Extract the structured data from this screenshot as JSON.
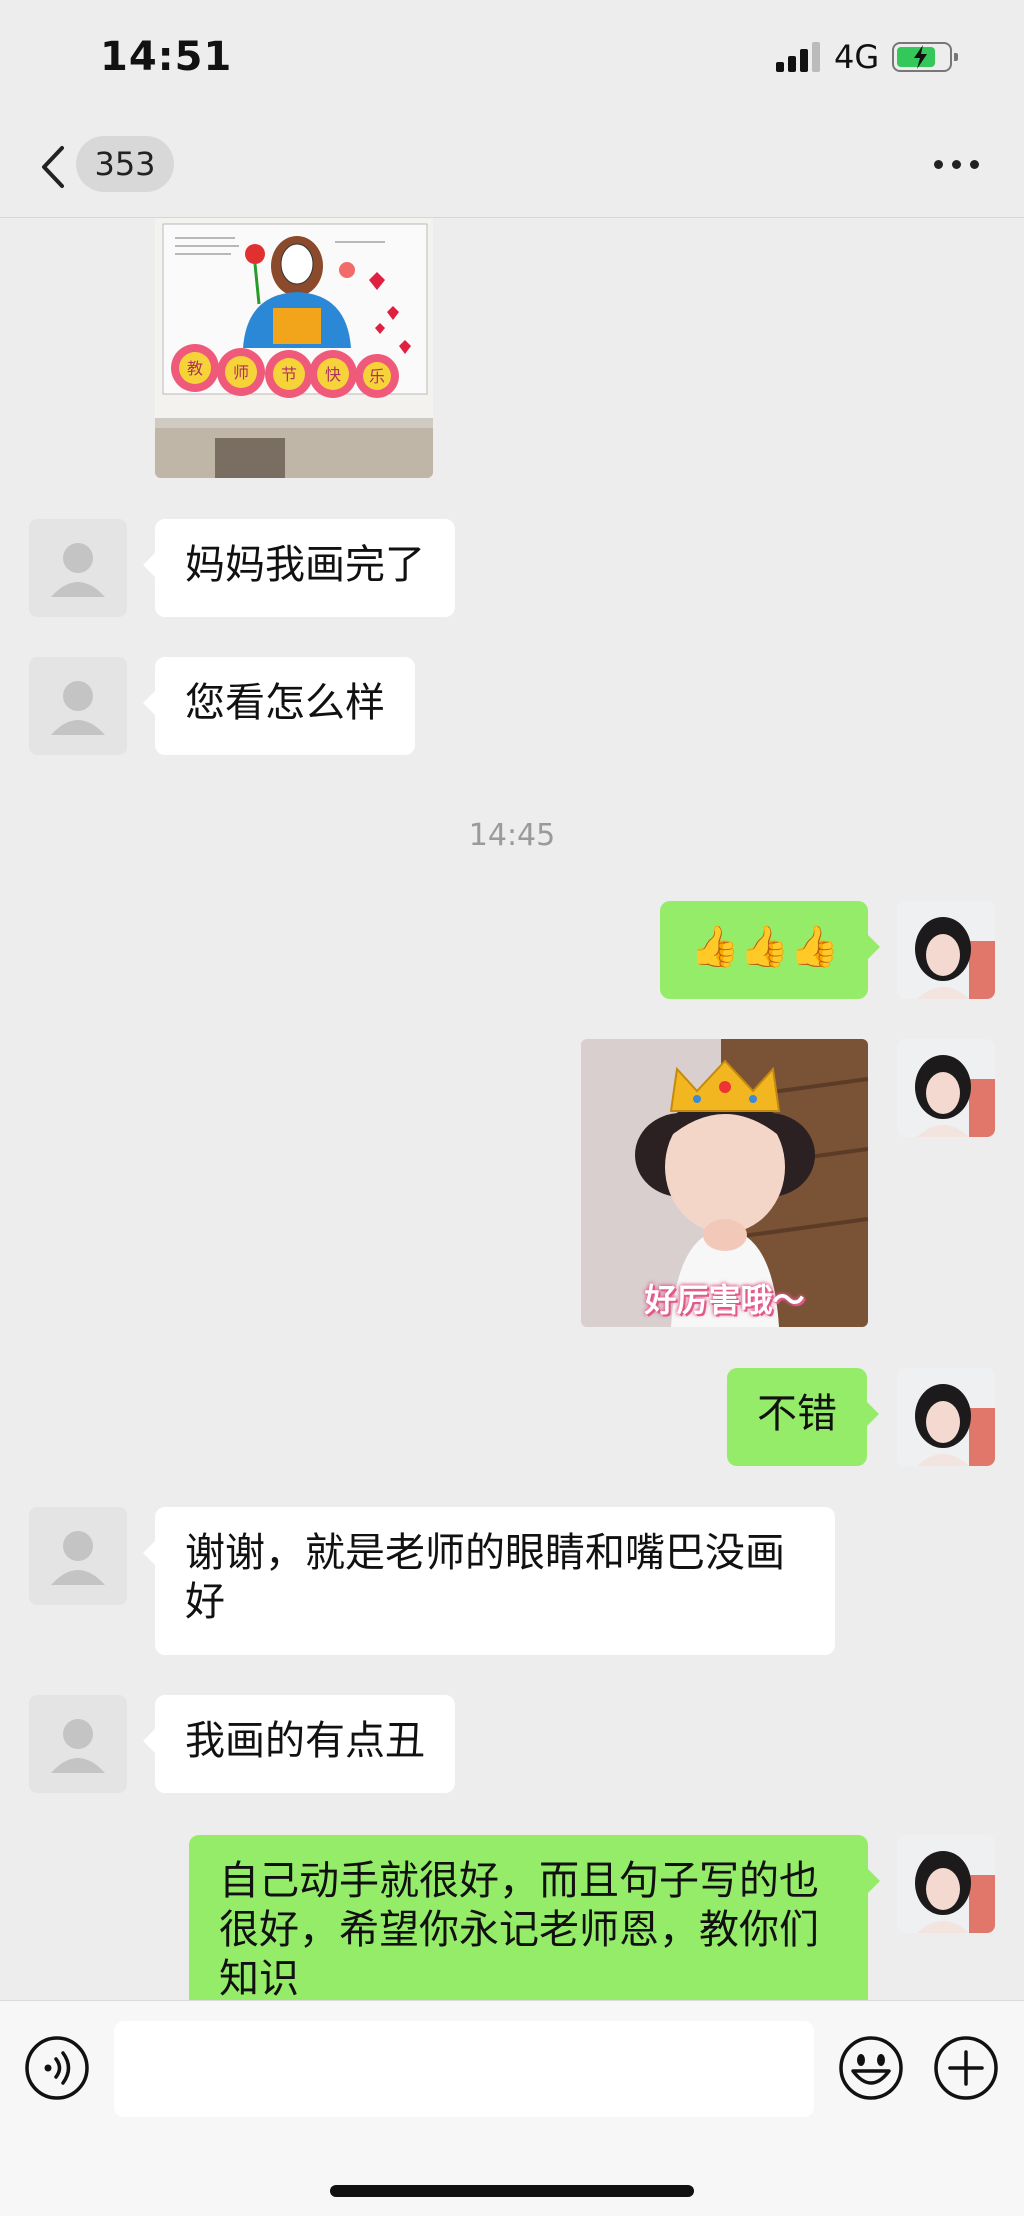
{
  "status_bar": {
    "time": "14:51",
    "network": "4G",
    "battery_charging": true,
    "battery_level": 0.75
  },
  "nav": {
    "unread_count": "353"
  },
  "messages": [
    {
      "id": "m1",
      "type": "text",
      "side": "in",
      "text": "妈妈我画完了"
    },
    {
      "id": "m2",
      "type": "text",
      "side": "in",
      "text": "您看怎么样"
    },
    {
      "id": "ts1",
      "type": "timestamp",
      "text": "14:45"
    },
    {
      "id": "m3",
      "type": "text",
      "side": "out",
      "text": "👍👍👍"
    },
    {
      "id": "m4",
      "type": "sticker",
      "side": "out",
      "caption": "好厉害哦～"
    },
    {
      "id": "m5",
      "type": "text",
      "side": "out",
      "text": "不错"
    },
    {
      "id": "m6",
      "type": "text",
      "side": "in",
      "text": "谢谢，就是老师的眼睛和嘴巴没画好"
    },
    {
      "id": "m7",
      "type": "text",
      "side": "in",
      "text": "我画的有点丑"
    },
    {
      "id": "m8",
      "type": "text",
      "side": "out",
      "text": "自己动手就很好，而且句子写的也很好，希望你永记老师恩，教你们知识"
    }
  ],
  "drawing": {
    "petals": [
      "教",
      "师",
      "节",
      "快",
      "乐"
    ]
  },
  "input_bar": {
    "placeholder": ""
  },
  "colors": {
    "background": "#ededed",
    "bubble_in": "#ffffff",
    "bubble_out": "#95ec69",
    "battery": "#34c759"
  },
  "icons": {
    "back": "chevron-left-icon",
    "more": "more-dots-icon",
    "voice": "voice-icon",
    "emoji": "emoji-icon",
    "plus": "plus-icon"
  }
}
